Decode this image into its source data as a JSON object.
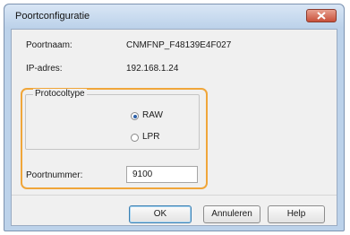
{
  "window": {
    "title": "Poortconfiguratie"
  },
  "fields": {
    "port_name_label": "Poortnaam:",
    "port_name_value": "CNMFNP_F48139E4F027",
    "ip_label": "IP-adres:",
    "ip_value": "192.168.1.24"
  },
  "protocol": {
    "group_label": "Protocoltype",
    "options": [
      {
        "label": "RAW",
        "selected": true
      },
      {
        "label": "LPR",
        "selected": false
      }
    ]
  },
  "port_number": {
    "label": "Poortnummer:",
    "value": "9100"
  },
  "buttons": {
    "ok": "OK",
    "cancel": "Annuleren",
    "help": "Help"
  },
  "colors": {
    "highlight": "#f0a63a",
    "close_button": "#c8503a",
    "frame": "#bcd2ea"
  }
}
